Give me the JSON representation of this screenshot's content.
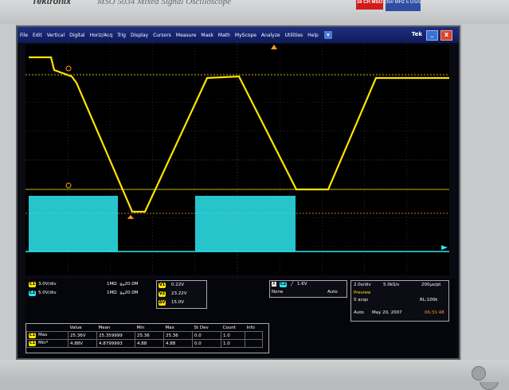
{
  "bezel": {
    "brand": "Tektronix",
    "model": "MSO 5034 Mixed Signal Oscilloscope",
    "badge_red": "16 CH MSO",
    "badge_blue": "350 MHz 5 GS/s"
  },
  "menu": {
    "items": [
      "File",
      "Edit",
      "Vertical",
      "Digital",
      "Horiz/Acq",
      "Trig",
      "Display",
      "Cursors",
      "Measure",
      "Mask",
      "Math",
      "MyScope",
      "Analyze",
      "Utilities",
      "Help"
    ],
    "brand": "Tek",
    "minimize": "_",
    "close": "X"
  },
  "colors": {
    "ch1": "#ffe400",
    "ch2": "#2ee6f0",
    "cursor": "#ff9a1f",
    "grid": "#4a4a4a"
  },
  "channels": [
    {
      "label": "C1",
      "scale": "3.0V/div",
      "impedance": "1MΩ",
      "bw": "20.0M"
    },
    {
      "label": "C2",
      "scale": "5.0V/div",
      "impedance": "1MΩ",
      "bw": "20.0M"
    }
  ],
  "cursors": {
    "v1": "0.22V",
    "v2": "23.22V",
    "dv": "15.0V",
    "v1_label": "V1",
    "v2_label": "V2",
    "dv_label": "ΔV"
  },
  "trigger": {
    "mode_badge": "A",
    "source": "C2",
    "level": "1.6V",
    "type": "None",
    "mode": "Auto"
  },
  "acquisition": {
    "time_div": "2.0s/div",
    "sample_rate": "5.0kS/s",
    "pt": "200µs/pt",
    "preview": "Preview",
    "acqs": "0 acqs",
    "rl": "RL:100k",
    "mode": "Auto",
    "date": "May 20, 2007",
    "time": "06:31:48"
  },
  "measurements": {
    "headers": [
      "Value",
      "Mean",
      "Min",
      "Max",
      "St Dev",
      "Count",
      "Info"
    ],
    "rows": [
      {
        "channel": "C1",
        "name": "Max",
        "values": [
          "25.36V",
          "25.359999",
          "25.36",
          "25.36",
          "0.0",
          "1.0",
          ""
        ]
      },
      {
        "channel": "C1",
        "name": "Min*",
        "values": [
          "4.88V",
          "4.8799993",
          "4.88",
          "4.88",
          "0.0",
          "1.0",
          ""
        ]
      }
    ]
  }
}
